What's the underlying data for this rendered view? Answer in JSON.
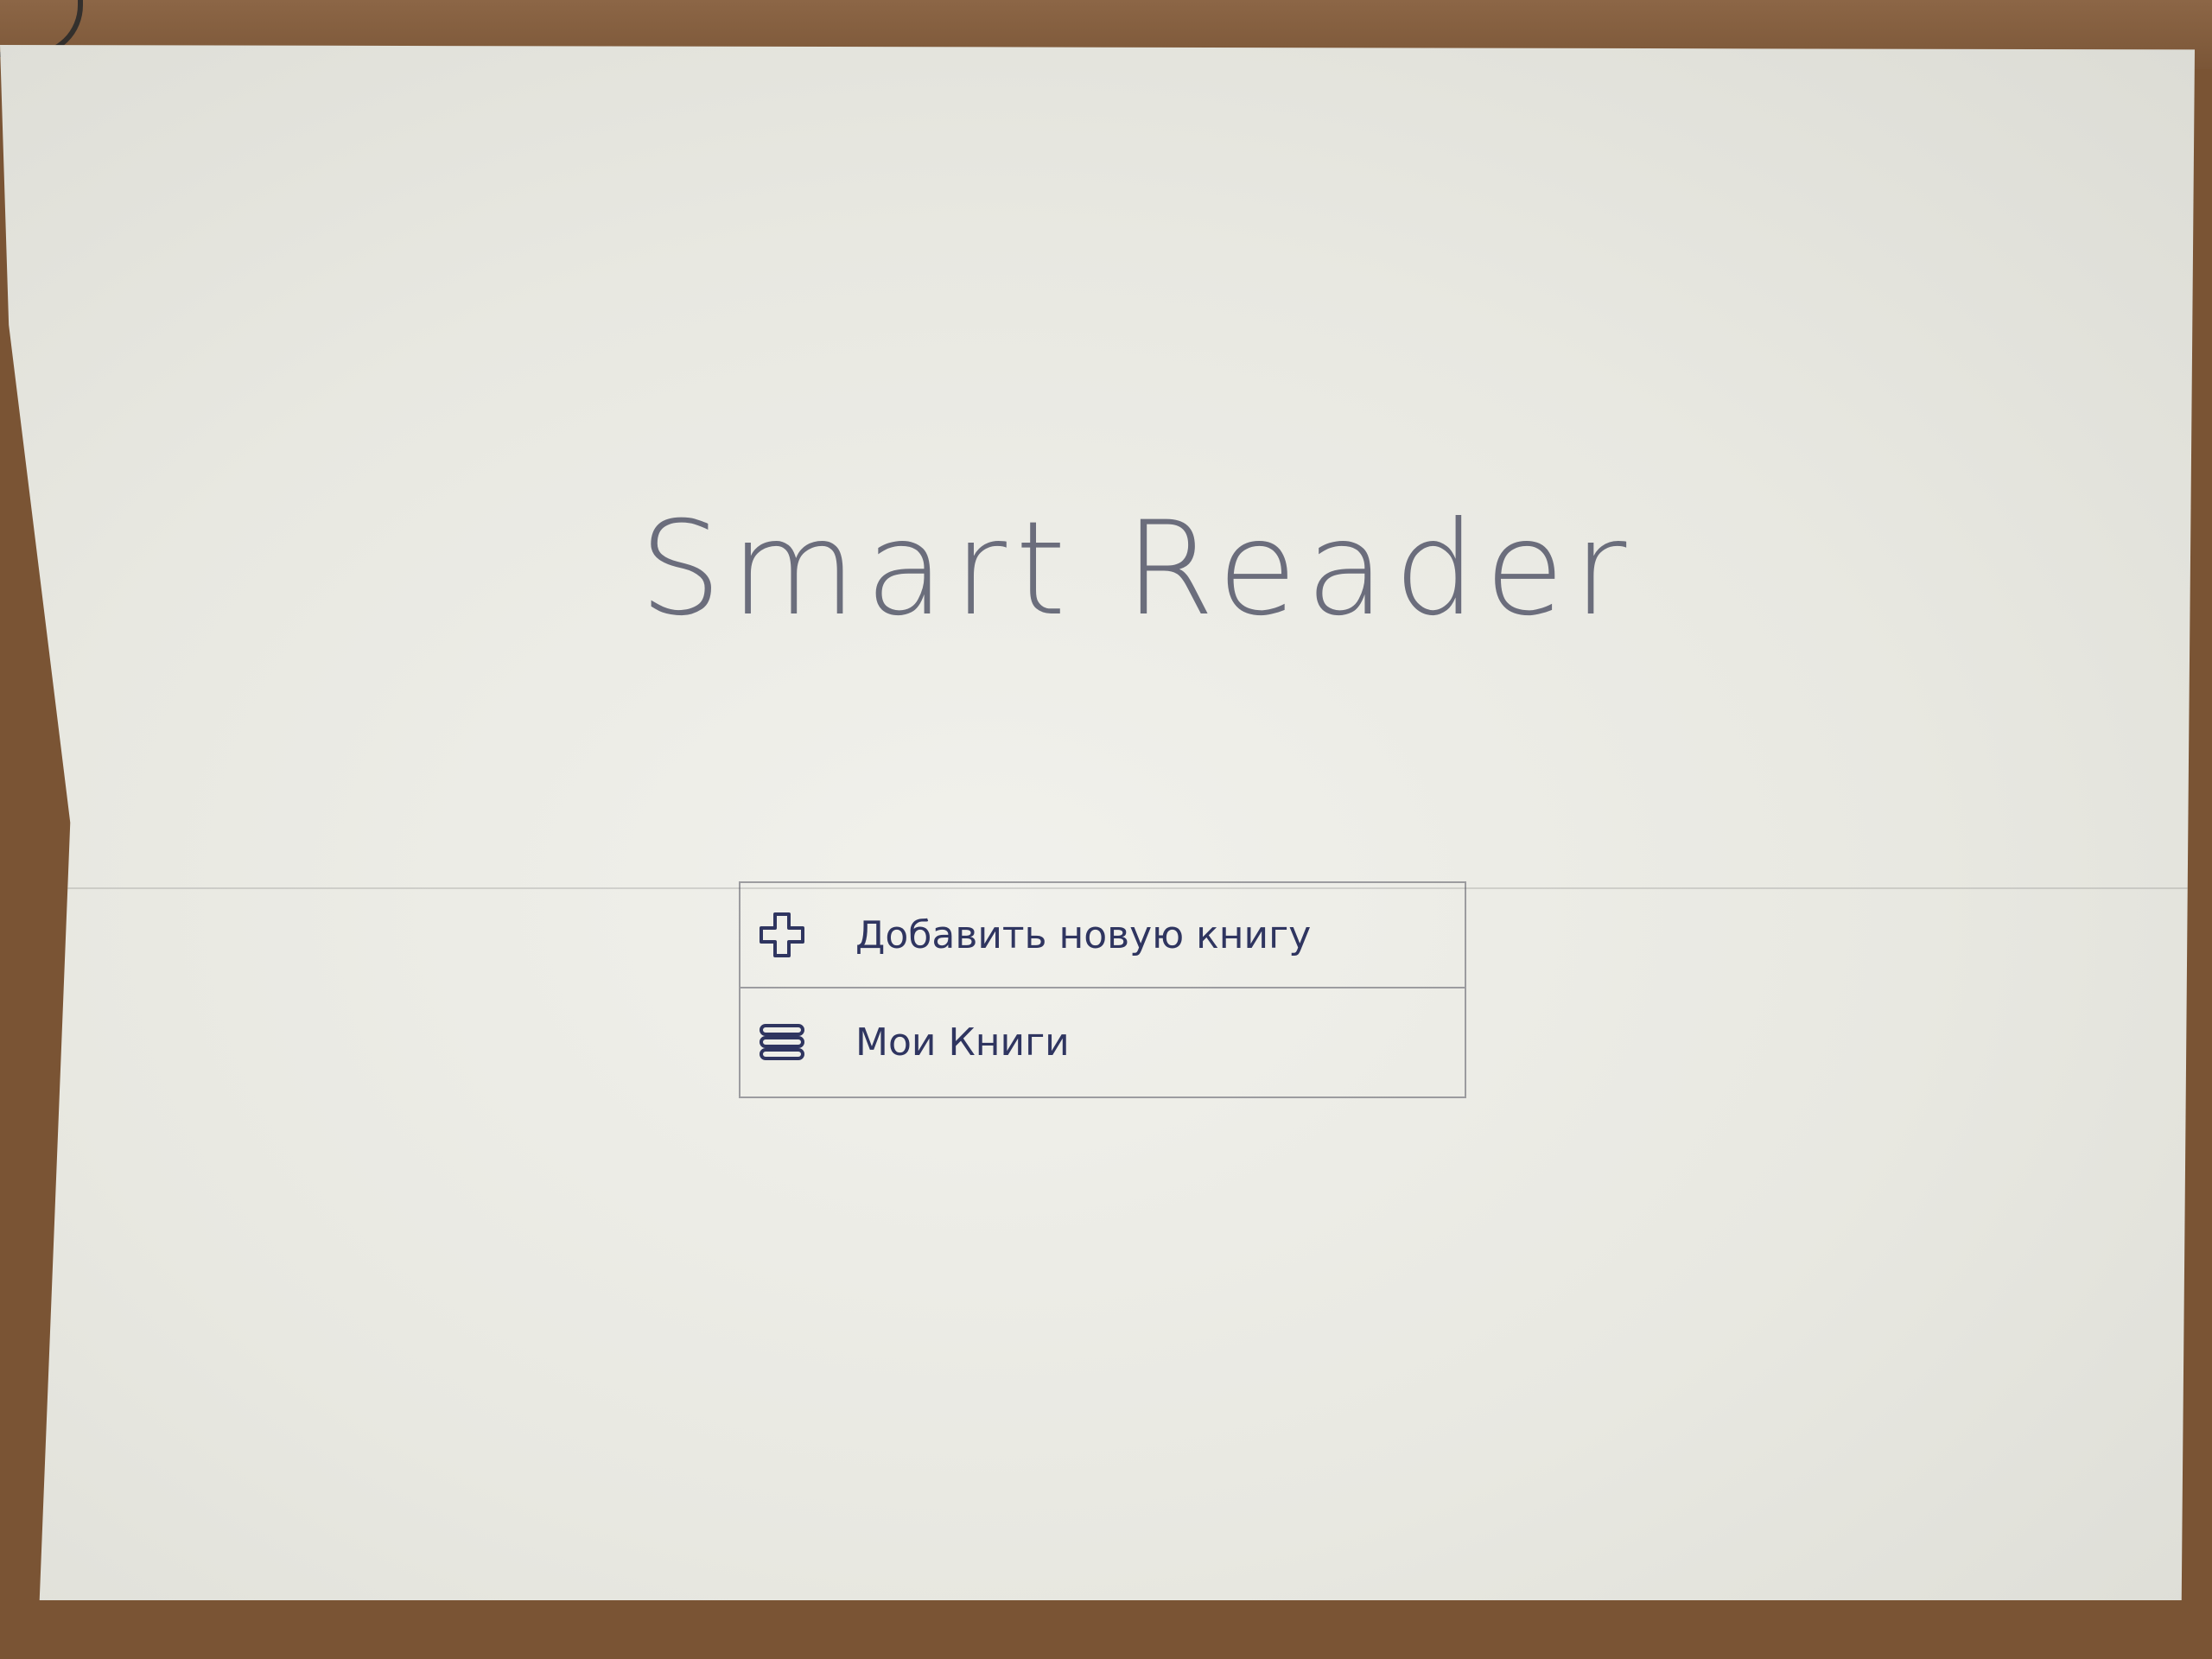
{
  "app": {
    "title": "Smart Reader"
  },
  "menu": {
    "items": [
      {
        "label": "Добавить новую книгу",
        "icon": "plus-icon"
      },
      {
        "label": "Мои Книги",
        "icon": "books-stack-icon"
      }
    ]
  },
  "colors": {
    "ink": "#2f3560",
    "paper": "#e8e8e1",
    "desk": "#7a5434"
  }
}
